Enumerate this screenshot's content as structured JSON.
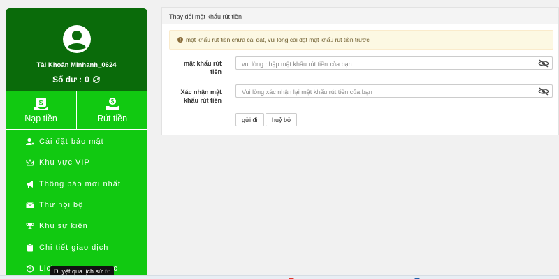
{
  "sidebar": {
    "account_name": "Tài Khoản Minhanh_0624",
    "balance_label": "Số dư :",
    "balance_value": "0",
    "actions": [
      {
        "label": "Nạp tiền",
        "icon": "deposit-icon"
      },
      {
        "label": "Rút tiền",
        "icon": "withdraw-icon"
      }
    ],
    "menu": [
      {
        "label": "Cài đặt bảo mật",
        "icon": "user-settings-icon"
      },
      {
        "label": "Khu vực VIP",
        "icon": "crown-icon"
      },
      {
        "label": "Thông báo mới nhất",
        "icon": "megaphone-icon"
      },
      {
        "label": "Thư nội bộ",
        "icon": "envelope-icon"
      },
      {
        "label": "Khu sự kiện",
        "icon": "trophy-icon"
      },
      {
        "label": "Chi tiết giao dịch",
        "icon": "clipboard-icon"
      },
      {
        "label": "Lịch",
        "icon": "history-icon"
      }
    ],
    "tooltip": "Duyệt qua lịch sử",
    "menu_last_suffix": "c"
  },
  "card": {
    "title": "Thay đổi mật khẩu rút tiền",
    "alert": "mật khẩu rút tiền chưa cài đặt, vui lòng cài đặt mật khẩu rút tiền trước",
    "fields": [
      {
        "label_line1": "mật khẩu rút",
        "label_line2": "tiền",
        "placeholder": "vui lòng nhập mật khẩu rút tiền của bạn"
      },
      {
        "label_line1": "Xác nhận mật",
        "label_line2": "khẩu rút tiền",
        "placeholder": "Vui lòng xác nhận lại mật khẩu rút tiền của bạn"
      }
    ],
    "submit_label": "gửi đi",
    "cancel_label": "huỷ bỏ"
  },
  "colors": {
    "sidebar_green": "#11c911",
    "profile_dark_green": "#0a6b0a",
    "alert_bg": "#fcf8e3"
  }
}
